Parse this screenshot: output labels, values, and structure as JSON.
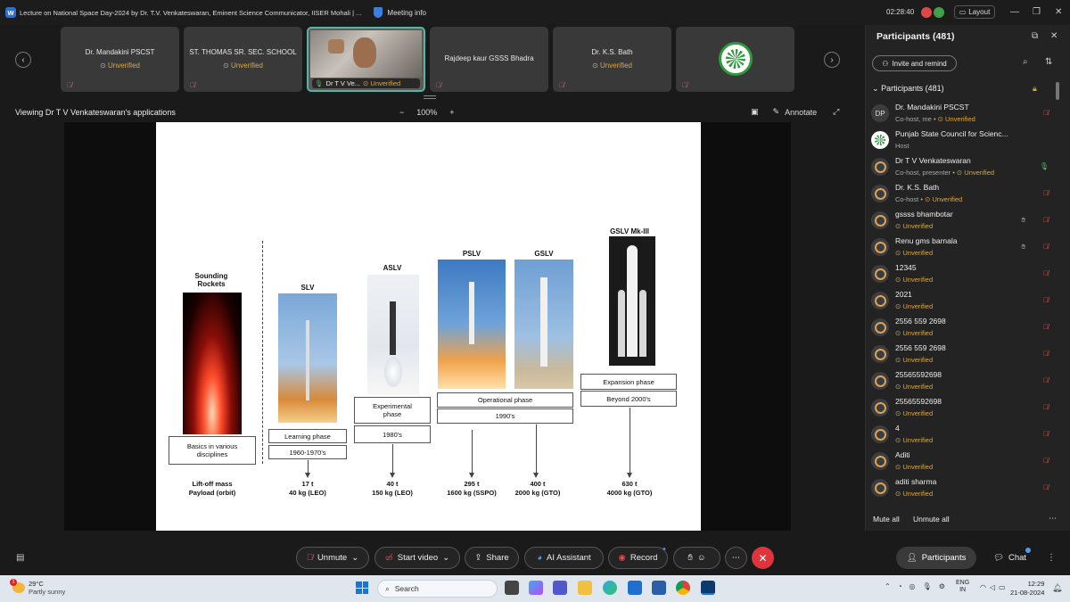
{
  "titlebar": {
    "meeting_title": "Lecture on National Space Day-2024 by Dr. T.V. Venkateswaran, Eminent Science Communicator, IISER Mohali | ...",
    "meeting_info": "Meeting info",
    "timer": "02:28:40",
    "layout_label": "Layout"
  },
  "filmstrip": {
    "tiles": [
      {
        "name": "Dr. Mandakini PSCST",
        "status": "Unverified"
      },
      {
        "name": "ST. THOMAS SR. SEC. SCHOOL",
        "status": "Unverified"
      },
      {
        "name": "Dr T V Ve...",
        "status": "Unverified"
      },
      {
        "name": "Rajdeep kaur GSSS Bhadra",
        "status": ""
      },
      {
        "name": "Dr. K.S. Bath",
        "status": "Unverified"
      }
    ]
  },
  "share": {
    "viewing_label": "Viewing Dr T V Venkateswaran's applications",
    "zoom": "100%",
    "zoom_minus": "−",
    "zoom_plus": "+",
    "annotate": "Annotate"
  },
  "slide": {
    "rockets": [
      {
        "label": "Sounding\nRockets",
        "phase": "Basics in various\ndisciplines",
        "mass": "Lift-off mass",
        "payload": "Payload (orbit)"
      },
      {
        "label": "SLV",
        "phase": "Learning phase",
        "period": "1960-1970's",
        "mass": "17 t",
        "payload": "40 kg (LEO)"
      },
      {
        "label": "ASLV",
        "phase": "Experimental\nphase",
        "period": "1980's",
        "mass": "40 t",
        "payload": "150 kg (LEO)"
      },
      {
        "label": "PSLV",
        "mass": "295 t",
        "payload": "1600 kg (SSPO)"
      },
      {
        "label": "GSLV",
        "mass": "400 t",
        "payload": "2000 kg (GTO)"
      },
      {
        "label": "GSLV Mk-III",
        "phase": "Expansion phase",
        "period": "Beyond 2000's",
        "mass": "630 t",
        "payload": "4000 kg (GTO)"
      }
    ],
    "operational_phase": "Operational phase",
    "operational_period": "1990's"
  },
  "panel": {
    "title": "Participants (481)",
    "invite": "Invite and remind",
    "section": "Participants (481)",
    "participants": [
      {
        "initials": "DP",
        "name": "Dr. Mandakini PSCST",
        "role": "Co-host, me",
        "unverified": "Unverified"
      },
      {
        "initials": "",
        "name": "Punjab State Council for Scienc...",
        "role": "Host",
        "unverified": ""
      },
      {
        "initials": "",
        "name": "Dr T V Venkateswaran",
        "role": "Co-host, presenter",
        "unverified": "Unverified"
      },
      {
        "initials": "",
        "name": "Dr. K.S. Bath",
        "role": "Co-host",
        "unverified": "Unverified"
      },
      {
        "initials": "",
        "name": "gssss bhambotar",
        "role": "",
        "unverified": "Unverified"
      },
      {
        "initials": "",
        "name": "Renu gms barnala",
        "role": "",
        "unverified": "Unverified"
      },
      {
        "initials": "",
        "name": "12345",
        "role": "",
        "unverified": "Unverified"
      },
      {
        "initials": "",
        "name": "2021",
        "role": "",
        "unverified": "Unverified"
      },
      {
        "initials": "",
        "name": "2556 559 2698",
        "role": "",
        "unverified": "Unverified"
      },
      {
        "initials": "",
        "name": "2556 559 2698",
        "role": "",
        "unverified": "Unverified"
      },
      {
        "initials": "",
        "name": "25565592698",
        "role": "",
        "unverified": "Unverified"
      },
      {
        "initials": "",
        "name": "25565592698",
        "role": "",
        "unverified": "Unverified"
      },
      {
        "initials": "",
        "name": "4",
        "role": "",
        "unverified": "Unverified"
      },
      {
        "initials": "",
        "name": "Aditi",
        "role": "",
        "unverified": "Unverified"
      },
      {
        "initials": "",
        "name": "aditi sharma",
        "role": "",
        "unverified": "Unverified"
      }
    ],
    "mute_all": "Mute all",
    "unmute_all": "Unmute all"
  },
  "controls": {
    "unmute": "Unmute",
    "start_video": "Start video",
    "share": "Share",
    "ai_assistant": "AI Assistant",
    "record": "Record",
    "participants": "Participants",
    "chat": "Chat"
  },
  "taskbar": {
    "temp": "29°C",
    "weather": "Partly sunny",
    "search": "Search",
    "lang1": "ENG",
    "lang2": "IN",
    "time": "12:29",
    "date": "21-08-2024",
    "notification_count": "1"
  }
}
